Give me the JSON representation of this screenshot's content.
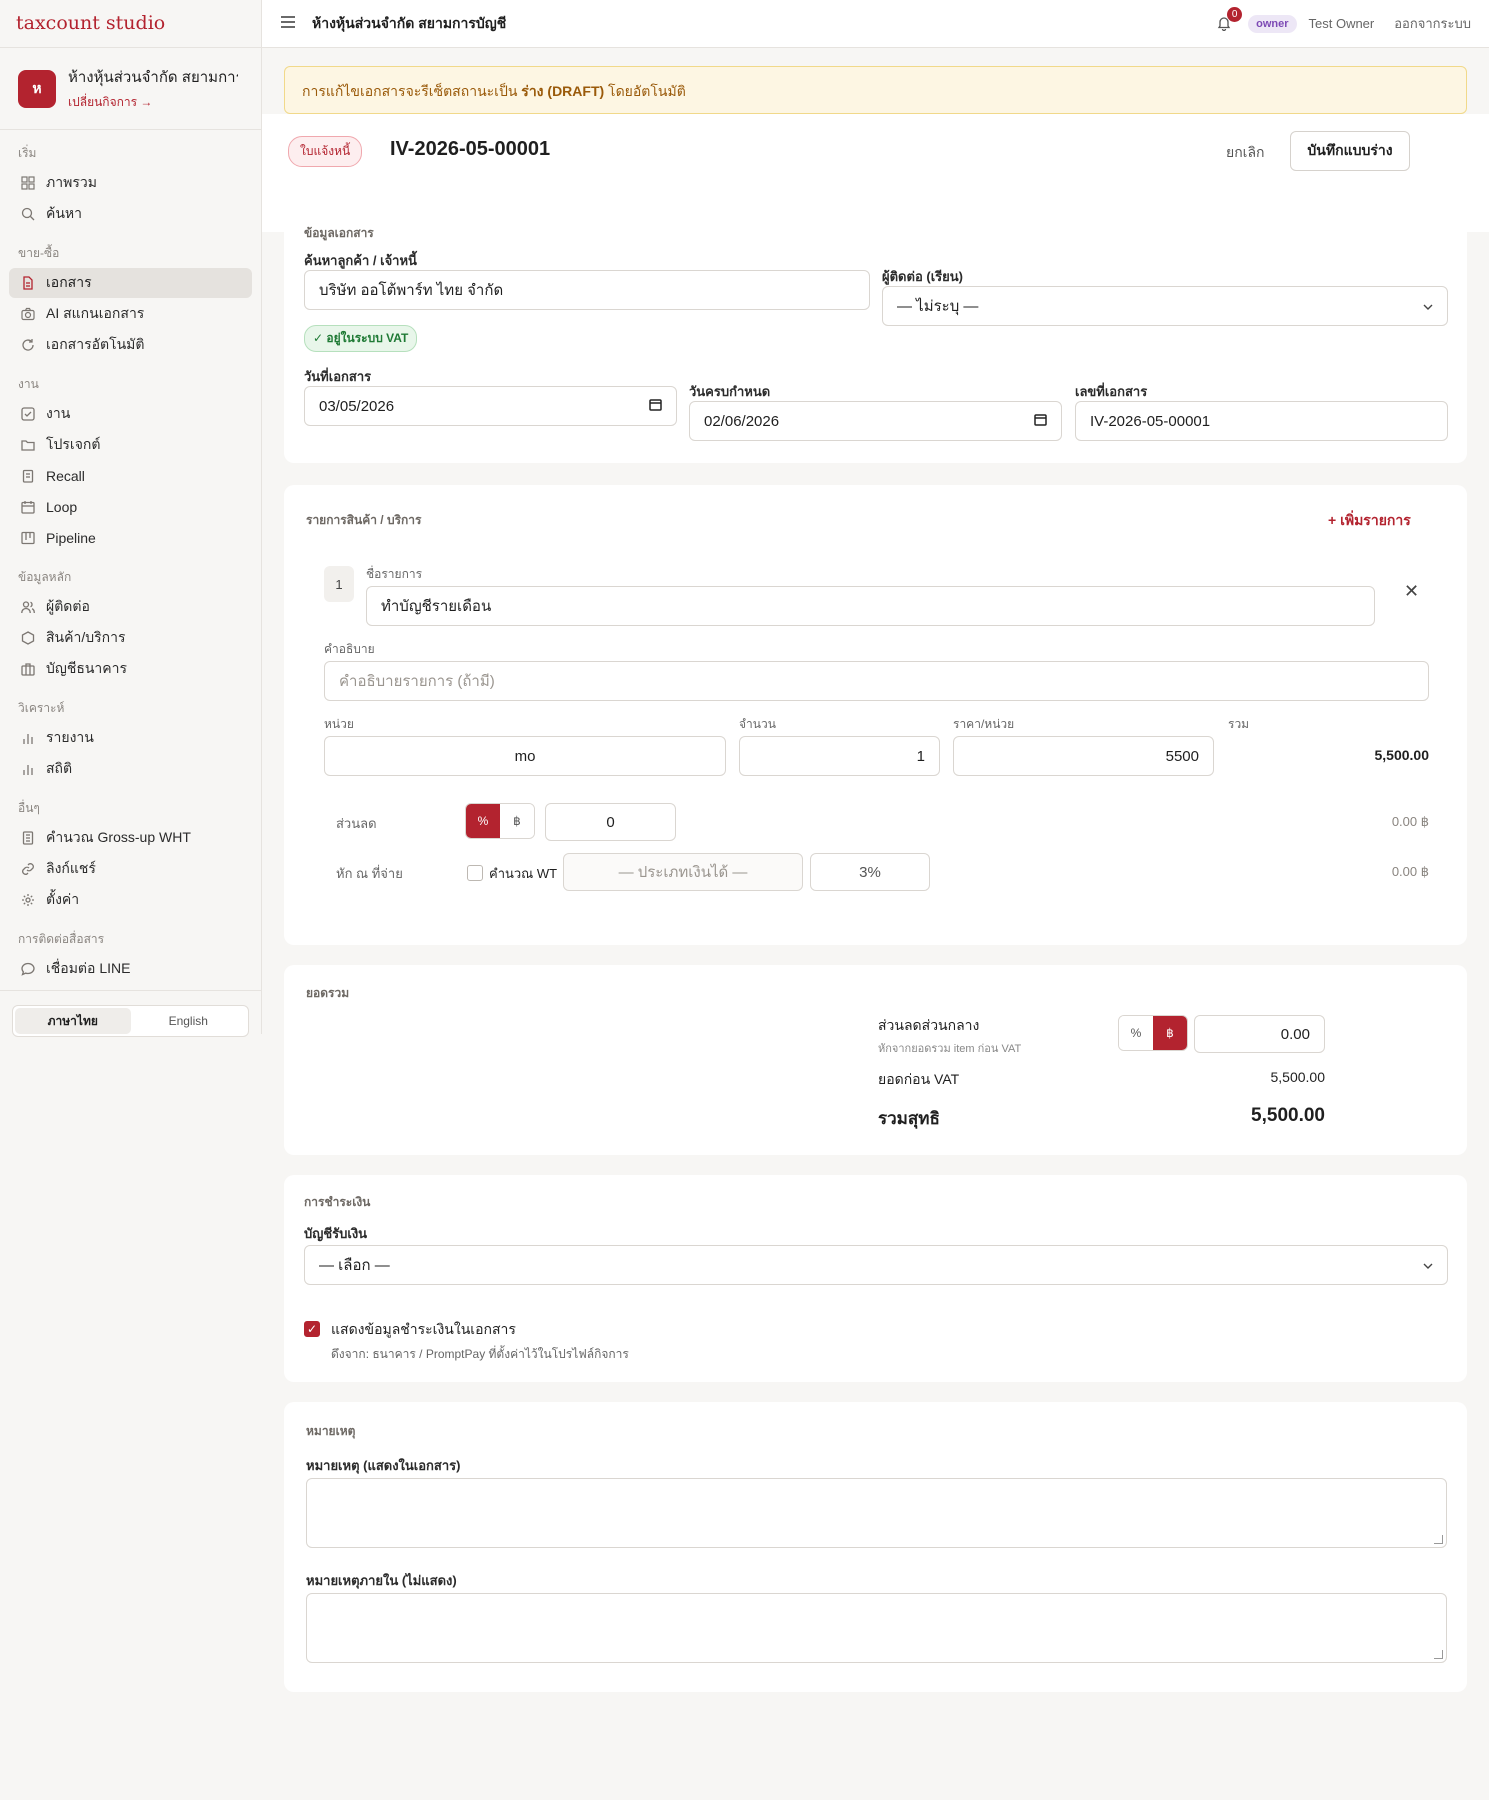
{
  "brand": "taxcount studio",
  "org": {
    "logo": "ห",
    "name": "ห้างหุ้นส่วนจำกัด สยามการ...",
    "switch": "เปลี่ยนกิจการ →"
  },
  "nav": {
    "s1": "เริ่ม",
    "overview": "ภาพรวม",
    "search": "ค้นหา",
    "s2": "ขาย-ซื้อ",
    "documents": "เอกสาร",
    "ai_scan": "AI สแกนเอกสาร",
    "auto_docs": "เอกสารอัตโนมัติ",
    "s3": "งาน",
    "tasks": "งาน",
    "projects": "โปรเจกต์",
    "recall": "Recall",
    "loop": "Loop",
    "pipeline": "Pipeline",
    "s4": "ข้อมูลหลัก",
    "contacts": "ผู้ติดต่อ",
    "products": "สินค้า/บริการ",
    "bank": "บัญชีธนาคาร",
    "s5": "วิเคราะห์",
    "reports": "รายงาน",
    "stats": "สถิติ",
    "s6": "อื่นๆ",
    "grossup": "คำนวณ Gross-up WHT",
    "links": "ลิงก์แชร์",
    "settings": "ตั้งค่า",
    "s7": "การติดต่อสื่อสาร",
    "line": "เชื่อมต่อ LINE"
  },
  "lang": {
    "th": "ภาษาไทย",
    "en": "English"
  },
  "topbar": {
    "title": "ห้างหุ้นส่วนจำกัด สยามการบัญชี",
    "notif_count": "0",
    "role": "owner",
    "user": "Test Owner",
    "logout": "ออกจากระบบ"
  },
  "banner": {
    "pre": "การแก้ไขเอกสารจะรีเซ็ตสถานะเป็น ",
    "bold": "ร่าง (DRAFT)",
    "post": " โดยอัตโนมัติ"
  },
  "doc": {
    "type": "ใบแจ้งหนี้",
    "number": "IV-2026-05-00001",
    "cancel": "ยกเลิก",
    "save": "บันทึกแบบร่าง"
  },
  "info": {
    "title": "ข้อมูลเอกสาร",
    "customer_label": "ค้นหาลูกค้า / เจ้าหนี้",
    "customer_value": "บริษัท ออโต้พาร์ท ไทย จำกัด",
    "vat_badge": "✓ อยู่ในระบบ VAT",
    "contact_label": "ผู้ติดต่อ (เรียน)",
    "contact_value": "— ไม่ระบุ —",
    "date_label": "วันที่เอกสาร",
    "date_value": "03/05/2026",
    "due_label": "วันครบกำหนด",
    "due_value": "02/06/2026",
    "no_label": "เลขที่เอกสาร",
    "no_value": "IV-2026-05-00001"
  },
  "items": {
    "title": "รายการสินค้า / บริการ",
    "add": "+ เพิ่มรายการ",
    "line_no": "1",
    "name_label": "ชื่อรายการ",
    "name_value": "ทำบัญชีรายเดือน",
    "desc_label": "คำอธิบาย",
    "desc_placeholder": "คำอธิบายรายการ (ถ้ามี)",
    "unit_label": "หน่วย",
    "unit_value": "mo",
    "qty_label": "จำนวน",
    "qty_value": "1",
    "price_label": "ราคา/หน่วย",
    "price_value": "5500",
    "total_label": "รวม",
    "total_value": "5,500.00",
    "discount_label": "ส่วนลด",
    "pct": "%",
    "baht": "฿",
    "discount_value": "0",
    "discount_amount": "0.00 ฿",
    "wht_label": "หัก ณ ที่จ่าย",
    "wht_check": "คำนวณ WT",
    "wht_type": "— ประเภทเงินได้ —",
    "wht_rate": "3%",
    "wht_amount": "0.00 ฿"
  },
  "summary": {
    "title": "ยอดรวม",
    "global_discount": "ส่วนลดส่วนกลาง",
    "global_discount_hint": "หักจากยอดรวม item ก่อน VAT",
    "pct": "%",
    "baht": "฿",
    "global_discount_value": "0.00",
    "pre_vat_label": "ยอดก่อน VAT",
    "pre_vat_value": "5,500.00",
    "net_label": "รวมสุทธิ",
    "net_value": "5,500.00"
  },
  "payment": {
    "title": "การชำระเงิน",
    "account_label": "บัญชีรับเงิน",
    "account_value": "— เลือก —",
    "show_label": "แสดงข้อมูลชำระเงินในเอกสาร",
    "show_hint": "ดึงจาก: ธนาคาร / PromptPay ที่ตั้งค่าไว้ในโปรไฟล์กิจการ"
  },
  "notes": {
    "title": "หมายเหตุ",
    "public_label": "หมายเหตุ (แสดงในเอกสาร)",
    "internal_label": "หมายเหตุภายใน (ไม่แสดง)"
  },
  "colors": {
    "accent": "#b3232f",
    "banner_bg": "#fdf6e3",
    "role_bg": "#ede7f6"
  }
}
